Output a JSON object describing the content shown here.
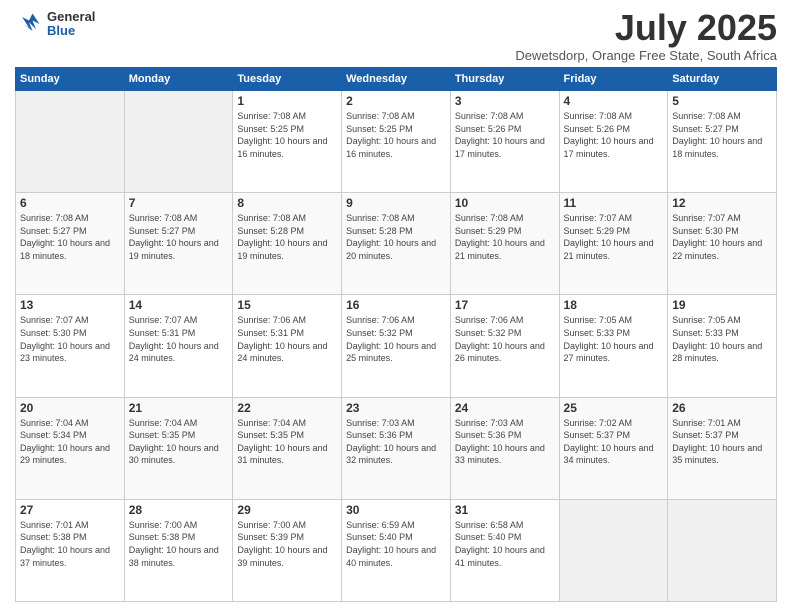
{
  "header": {
    "logo_general": "General",
    "logo_blue": "Blue",
    "month_title": "July 2025",
    "location": "Dewetsdorp, Orange Free State, South Africa"
  },
  "weekdays": [
    "Sunday",
    "Monday",
    "Tuesday",
    "Wednesday",
    "Thursday",
    "Friday",
    "Saturday"
  ],
  "weeks": [
    [
      {
        "day": "",
        "sunrise": "",
        "sunset": "",
        "daylight": ""
      },
      {
        "day": "",
        "sunrise": "",
        "sunset": "",
        "daylight": ""
      },
      {
        "day": "1",
        "sunrise": "Sunrise: 7:08 AM",
        "sunset": "Sunset: 5:25 PM",
        "daylight": "Daylight: 10 hours and 16 minutes."
      },
      {
        "day": "2",
        "sunrise": "Sunrise: 7:08 AM",
        "sunset": "Sunset: 5:25 PM",
        "daylight": "Daylight: 10 hours and 16 minutes."
      },
      {
        "day": "3",
        "sunrise": "Sunrise: 7:08 AM",
        "sunset": "Sunset: 5:26 PM",
        "daylight": "Daylight: 10 hours and 17 minutes."
      },
      {
        "day": "4",
        "sunrise": "Sunrise: 7:08 AM",
        "sunset": "Sunset: 5:26 PM",
        "daylight": "Daylight: 10 hours and 17 minutes."
      },
      {
        "day": "5",
        "sunrise": "Sunrise: 7:08 AM",
        "sunset": "Sunset: 5:27 PM",
        "daylight": "Daylight: 10 hours and 18 minutes."
      }
    ],
    [
      {
        "day": "6",
        "sunrise": "Sunrise: 7:08 AM",
        "sunset": "Sunset: 5:27 PM",
        "daylight": "Daylight: 10 hours and 18 minutes."
      },
      {
        "day": "7",
        "sunrise": "Sunrise: 7:08 AM",
        "sunset": "Sunset: 5:27 PM",
        "daylight": "Daylight: 10 hours and 19 minutes."
      },
      {
        "day": "8",
        "sunrise": "Sunrise: 7:08 AM",
        "sunset": "Sunset: 5:28 PM",
        "daylight": "Daylight: 10 hours and 19 minutes."
      },
      {
        "day": "9",
        "sunrise": "Sunrise: 7:08 AM",
        "sunset": "Sunset: 5:28 PM",
        "daylight": "Daylight: 10 hours and 20 minutes."
      },
      {
        "day": "10",
        "sunrise": "Sunrise: 7:08 AM",
        "sunset": "Sunset: 5:29 PM",
        "daylight": "Daylight: 10 hours and 21 minutes."
      },
      {
        "day": "11",
        "sunrise": "Sunrise: 7:07 AM",
        "sunset": "Sunset: 5:29 PM",
        "daylight": "Daylight: 10 hours and 21 minutes."
      },
      {
        "day": "12",
        "sunrise": "Sunrise: 7:07 AM",
        "sunset": "Sunset: 5:30 PM",
        "daylight": "Daylight: 10 hours and 22 minutes."
      }
    ],
    [
      {
        "day": "13",
        "sunrise": "Sunrise: 7:07 AM",
        "sunset": "Sunset: 5:30 PM",
        "daylight": "Daylight: 10 hours and 23 minutes."
      },
      {
        "day": "14",
        "sunrise": "Sunrise: 7:07 AM",
        "sunset": "Sunset: 5:31 PM",
        "daylight": "Daylight: 10 hours and 24 minutes."
      },
      {
        "day": "15",
        "sunrise": "Sunrise: 7:06 AM",
        "sunset": "Sunset: 5:31 PM",
        "daylight": "Daylight: 10 hours and 24 minutes."
      },
      {
        "day": "16",
        "sunrise": "Sunrise: 7:06 AM",
        "sunset": "Sunset: 5:32 PM",
        "daylight": "Daylight: 10 hours and 25 minutes."
      },
      {
        "day": "17",
        "sunrise": "Sunrise: 7:06 AM",
        "sunset": "Sunset: 5:32 PM",
        "daylight": "Daylight: 10 hours and 26 minutes."
      },
      {
        "day": "18",
        "sunrise": "Sunrise: 7:05 AM",
        "sunset": "Sunset: 5:33 PM",
        "daylight": "Daylight: 10 hours and 27 minutes."
      },
      {
        "day": "19",
        "sunrise": "Sunrise: 7:05 AM",
        "sunset": "Sunset: 5:33 PM",
        "daylight": "Daylight: 10 hours and 28 minutes."
      }
    ],
    [
      {
        "day": "20",
        "sunrise": "Sunrise: 7:04 AM",
        "sunset": "Sunset: 5:34 PM",
        "daylight": "Daylight: 10 hours and 29 minutes."
      },
      {
        "day": "21",
        "sunrise": "Sunrise: 7:04 AM",
        "sunset": "Sunset: 5:35 PM",
        "daylight": "Daylight: 10 hours and 30 minutes."
      },
      {
        "day": "22",
        "sunrise": "Sunrise: 7:04 AM",
        "sunset": "Sunset: 5:35 PM",
        "daylight": "Daylight: 10 hours and 31 minutes."
      },
      {
        "day": "23",
        "sunrise": "Sunrise: 7:03 AM",
        "sunset": "Sunset: 5:36 PM",
        "daylight": "Daylight: 10 hours and 32 minutes."
      },
      {
        "day": "24",
        "sunrise": "Sunrise: 7:03 AM",
        "sunset": "Sunset: 5:36 PM",
        "daylight": "Daylight: 10 hours and 33 minutes."
      },
      {
        "day": "25",
        "sunrise": "Sunrise: 7:02 AM",
        "sunset": "Sunset: 5:37 PM",
        "daylight": "Daylight: 10 hours and 34 minutes."
      },
      {
        "day": "26",
        "sunrise": "Sunrise: 7:01 AM",
        "sunset": "Sunset: 5:37 PM",
        "daylight": "Daylight: 10 hours and 35 minutes."
      }
    ],
    [
      {
        "day": "27",
        "sunrise": "Sunrise: 7:01 AM",
        "sunset": "Sunset: 5:38 PM",
        "daylight": "Daylight: 10 hours and 37 minutes."
      },
      {
        "day": "28",
        "sunrise": "Sunrise: 7:00 AM",
        "sunset": "Sunset: 5:38 PM",
        "daylight": "Daylight: 10 hours and 38 minutes."
      },
      {
        "day": "29",
        "sunrise": "Sunrise: 7:00 AM",
        "sunset": "Sunset: 5:39 PM",
        "daylight": "Daylight: 10 hours and 39 minutes."
      },
      {
        "day": "30",
        "sunrise": "Sunrise: 6:59 AM",
        "sunset": "Sunset: 5:40 PM",
        "daylight": "Daylight: 10 hours and 40 minutes."
      },
      {
        "day": "31",
        "sunrise": "Sunrise: 6:58 AM",
        "sunset": "Sunset: 5:40 PM",
        "daylight": "Daylight: 10 hours and 41 minutes."
      },
      {
        "day": "",
        "sunrise": "",
        "sunset": "",
        "daylight": ""
      },
      {
        "day": "",
        "sunrise": "",
        "sunset": "",
        "daylight": ""
      }
    ]
  ]
}
